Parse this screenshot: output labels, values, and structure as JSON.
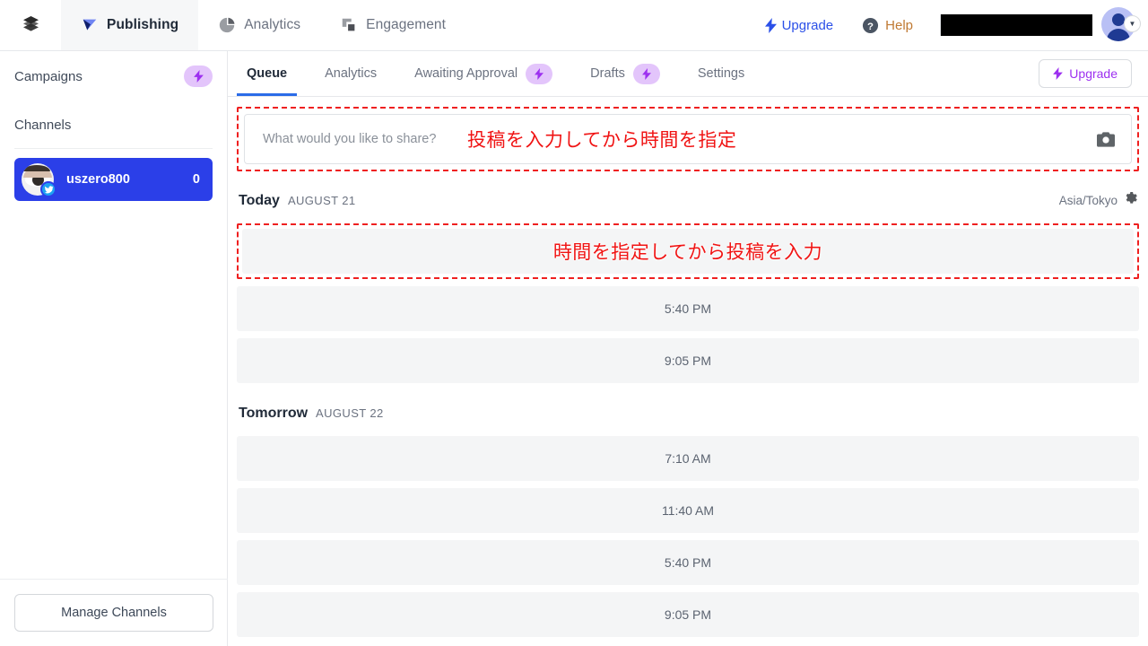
{
  "topbar": {
    "menu_icon": "layers-icon",
    "nav": [
      {
        "label": "Publishing",
        "icon": "flag-icon",
        "active": true
      },
      {
        "label": "Analytics",
        "icon": "pie-chart-icon",
        "active": false
      },
      {
        "label": "Engagement",
        "icon": "squares-icon",
        "active": false
      }
    ],
    "upgrade_label": "Upgrade",
    "upgrade_icon": "bolt-icon",
    "help_label": "Help",
    "help_icon": "question-circle-icon",
    "account_name_redacted": "",
    "avatar_icon": "user-avatar",
    "avatar_caret": "▼"
  },
  "sidebar": {
    "campaigns_label": "Campaigns",
    "campaigns_badge_icon": "bolt-icon",
    "channels_label": "Channels",
    "channels": [
      {
        "name": "uszero800",
        "count": "0",
        "network": "twitter",
        "selected": true
      }
    ],
    "manage_channels_label": "Manage Channels"
  },
  "tabs": [
    {
      "label": "Queue",
      "active": true,
      "badge": false
    },
    {
      "label": "Analytics",
      "active": false,
      "badge": false
    },
    {
      "label": "Awaiting Approval",
      "active": false,
      "badge": true,
      "badge_icon": "bolt-icon"
    },
    {
      "label": "Drafts",
      "active": false,
      "badge": true,
      "badge_icon": "bolt-icon"
    },
    {
      "label": "Settings",
      "active": false,
      "badge": false
    }
  ],
  "tabbar_upgrade": {
    "label": "Upgrade",
    "icon": "bolt-icon"
  },
  "composer": {
    "placeholder": "What would you like to share?",
    "media_icon": "camera-icon",
    "annotation": "投稿を入力してから時間を指定"
  },
  "queue": {
    "timezone": "Asia/Tokyo",
    "timezone_gear_icon": "gear-icon",
    "days": [
      {
        "title": "Today",
        "date": "AUGUST 21",
        "slots": [
          {
            "time": "",
            "annotated": true,
            "annotation": "時間を指定してから投稿を入力"
          },
          {
            "time": "5:40 PM",
            "annotated": false
          },
          {
            "time": "9:05 PM",
            "annotated": false
          }
        ]
      },
      {
        "title": "Tomorrow",
        "date": "AUGUST 22",
        "slots": [
          {
            "time": "7:10 AM",
            "annotated": false
          },
          {
            "time": "11:40 AM",
            "annotated": false
          },
          {
            "time": "5:40 PM",
            "annotated": false
          },
          {
            "time": "9:05 PM",
            "annotated": false
          }
        ]
      }
    ]
  },
  "colors": {
    "accent_blue": "#2b3fe8",
    "link_blue": "#2b50e8",
    "purple": "#9d30f0",
    "purple_pill": "#e3c5fb",
    "annotation_red": "#ef2020",
    "twitter_blue": "#1da1f2",
    "tab_underline": "#2b6ce8"
  }
}
